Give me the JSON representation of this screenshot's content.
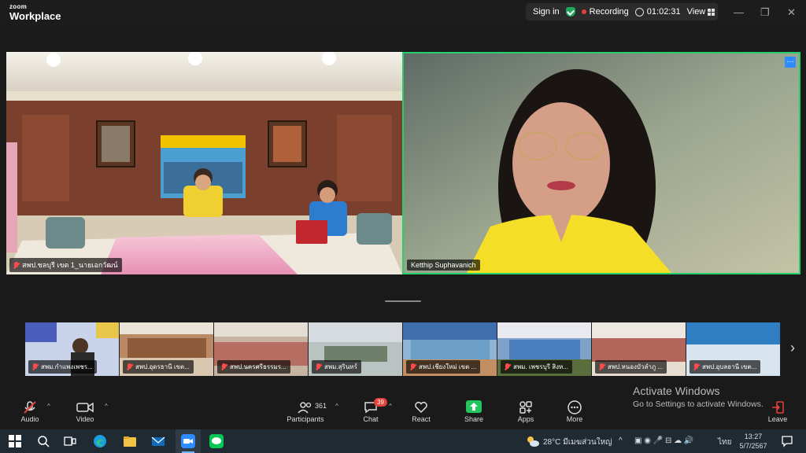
{
  "titlebar": {
    "brand_small": "zoom",
    "brand_big": "Workplace",
    "signin_label": "Sign in",
    "recording_label": "Recording",
    "elapsed": "01:02:31",
    "view_label": "View"
  },
  "main_tiles": [
    {
      "name": "สพป.ชลบุรี เขต 1_นายเอกวัฒน์"
    },
    {
      "name": "Ketthip Suphavanich"
    }
  ],
  "thumbnails": [
    {
      "name": "สพม.กำแพงเพชร..."
    },
    {
      "name": "สพป.อุดรธานี เขต..."
    },
    {
      "name": "สพป.นครศรีธรรมร..."
    },
    {
      "name": "สพม.สุรินทร์"
    },
    {
      "name": "สพป.เชียงใหม่ เขต ..."
    },
    {
      "name": "สพม. เพชรบุรี สิงห..."
    },
    {
      "name": "สพป.หนองบัวลำภู ..."
    },
    {
      "name": "สพป.อุบลธานี เขต..."
    }
  ],
  "toolbar": {
    "audio_label": "Audio",
    "video_label": "Video",
    "participants_label": "Participants",
    "participants_count": "361",
    "chat_label": "Chat",
    "chat_badge": "39",
    "react_label": "React",
    "share_label": "Share",
    "apps_label": "Apps",
    "more_label": "More",
    "leave_label": "Leave"
  },
  "activate_windows": {
    "title": "Activate Windows",
    "subtitle": "Go to Settings to activate Windows."
  },
  "taskbar": {
    "weather": "28°C  มีเมฆส่วนใหญ่",
    "language": "ไทย",
    "time": "13:27",
    "date": "5/7/2567"
  },
  "colors": {
    "active_speaker_border": "#25d06c",
    "share_green": "#24c55e",
    "recording_red": "#e5413a",
    "leave_red": "#e5413a",
    "badge_blue": "#2d8cff"
  },
  "icons": [
    "shield-check-icon",
    "clock-icon",
    "grid-view-icon",
    "mic-off-icon",
    "camera-icon",
    "participants-icon",
    "chat-icon",
    "heart-icon",
    "share-arrow-icon",
    "apps-icon",
    "more-dots-icon",
    "leave-icon",
    "windows-start-icon",
    "search-icon",
    "task-view-icon",
    "edge-icon",
    "folder-icon",
    "mail-icon",
    "zoom-icon",
    "line-icon"
  ]
}
